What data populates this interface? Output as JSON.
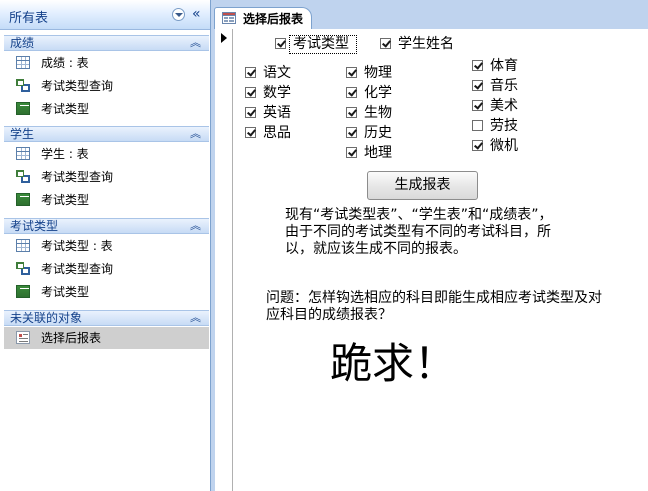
{
  "nav": {
    "title": "所有表",
    "groups": [
      {
        "label": "成绩",
        "items": [
          {
            "label": "成绩 : 表",
            "icon": "table-icon"
          },
          {
            "label": "考试类型查询",
            "icon": "query-icon"
          },
          {
            "label": "考试类型",
            "icon": "form-icon"
          }
        ]
      },
      {
        "label": "学生",
        "items": [
          {
            "label": "学生 : 表",
            "icon": "table-icon"
          },
          {
            "label": "考试类型查询",
            "icon": "query-icon"
          },
          {
            "label": "考试类型",
            "icon": "form-icon"
          }
        ]
      },
      {
        "label": "考试类型",
        "items": [
          {
            "label": "考试类型 : 表",
            "icon": "table-icon"
          },
          {
            "label": "考试类型查询",
            "icon": "query-icon"
          },
          {
            "label": "考试类型",
            "icon": "form-icon"
          }
        ]
      },
      {
        "label": "未关联的对象",
        "items": [
          {
            "label": "选择后报表",
            "icon": "report-icon",
            "selected": true
          }
        ]
      }
    ]
  },
  "tab": {
    "label": "选择后报表",
    "icon": "form-tab-icon"
  },
  "form": {
    "top_checks": [
      {
        "label": "考试类型",
        "checked": true
      },
      {
        "label": "学生姓名",
        "checked": true
      }
    ],
    "col1": [
      {
        "label": "语文",
        "checked": true
      },
      {
        "label": "数学",
        "checked": true
      },
      {
        "label": "英语",
        "checked": true
      },
      {
        "label": "思品",
        "checked": true
      }
    ],
    "col2": [
      {
        "label": "物理",
        "checked": true
      },
      {
        "label": "化学",
        "checked": true
      },
      {
        "label": "生物",
        "checked": true
      },
      {
        "label": "历史",
        "checked": true
      },
      {
        "label": "地理",
        "checked": true
      }
    ],
    "col3": [
      {
        "label": "体育",
        "checked": true
      },
      {
        "label": "音乐",
        "checked": true
      },
      {
        "label": "美术",
        "checked": true
      },
      {
        "label": "劳技",
        "checked": false
      },
      {
        "label": "微机",
        "checked": true
      }
    ],
    "generate_button": "生成报表",
    "description": "现有“考试类型表”、“学生表”和“成绩表”，由于不同的考试类型有不同的考试科目，所以，就应该生成不同的报表。",
    "question": "问题：怎样钩选相应的科目即能生成相应考试类型及对应科目的成绩报表？",
    "plea": "跪求！"
  }
}
